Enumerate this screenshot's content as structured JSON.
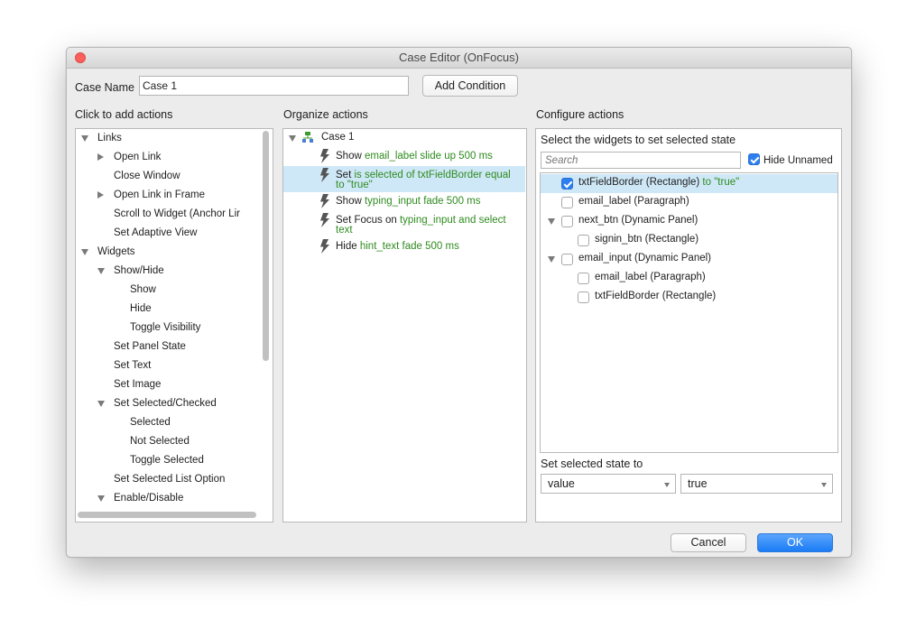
{
  "window": {
    "title": "Case Editor (OnFocus)"
  },
  "case_name": {
    "label": "Case Name",
    "value": "Case 1",
    "add_condition_label": "Add Condition"
  },
  "left": {
    "header": "Click to add actions",
    "items": [
      {
        "label": "Links",
        "caret": "down",
        "level": 0
      },
      {
        "label": "Open Link",
        "caret": "right",
        "level": 1
      },
      {
        "label": "Close Window",
        "caret": "",
        "level": 1
      },
      {
        "label": "Open Link in Frame",
        "caret": "right",
        "level": 1
      },
      {
        "label": "Scroll to Widget (Anchor Lir",
        "caret": "",
        "level": 1
      },
      {
        "label": "Set Adaptive View",
        "caret": "",
        "level": 1
      },
      {
        "label": "Widgets",
        "caret": "down",
        "level": 0
      },
      {
        "label": "Show/Hide",
        "caret": "down",
        "level": 1
      },
      {
        "label": "Show",
        "caret": "",
        "level": 2
      },
      {
        "label": "Hide",
        "caret": "",
        "level": 2
      },
      {
        "label": "Toggle Visibility",
        "caret": "",
        "level": 2
      },
      {
        "label": "Set Panel State",
        "caret": "",
        "level": 1
      },
      {
        "label": "Set Text",
        "caret": "",
        "level": 1
      },
      {
        "label": "Set Image",
        "caret": "",
        "level": 1
      },
      {
        "label": "Set Selected/Checked",
        "caret": "down",
        "level": 1
      },
      {
        "label": "Selected",
        "caret": "",
        "level": 2
      },
      {
        "label": "Not Selected",
        "caret": "",
        "level": 2
      },
      {
        "label": "Toggle Selected",
        "caret": "",
        "level": 2
      },
      {
        "label": "Set Selected List Option",
        "caret": "",
        "level": 1
      },
      {
        "label": "Enable/Disable",
        "caret": "down",
        "level": 1
      }
    ]
  },
  "middle": {
    "header": "Organize actions",
    "case_label": "Case 1",
    "actions": [
      {
        "verb": "Show",
        "line1": "email_label slide up 500 ms",
        "line2": "",
        "selected": false
      },
      {
        "verb": "Set",
        "line1": "is selected of txtFieldBorder equal",
        "line2": "to \"true\"",
        "selected": true
      },
      {
        "verb": "Show",
        "line1": "typing_input fade 500 ms",
        "line2": "",
        "selected": false
      },
      {
        "verb": "Set Focus on",
        "line1": "typing_input and select",
        "line2": "text",
        "selected": false
      },
      {
        "verb": "Hide",
        "line1": "hint_text fade 500 ms",
        "line2": "",
        "selected": false
      }
    ]
  },
  "right": {
    "header": "Configure actions",
    "select_label": "Select the widgets to set selected state",
    "search_placeholder": "Search",
    "hide_unnamed_label": "Hide Unnamed",
    "widgets": [
      {
        "name": "txtFieldBorder (Rectangle)",
        "suffix": " to \"true\"",
        "checked": true,
        "caret": false,
        "level": 0,
        "selected": true
      },
      {
        "name": "email_label (Paragraph)",
        "suffix": "",
        "checked": false,
        "caret": false,
        "level": 0,
        "selected": false
      },
      {
        "name": "next_btn (Dynamic Panel)",
        "suffix": "",
        "checked": false,
        "caret": true,
        "level": 0,
        "selected": false
      },
      {
        "name": "signin_btn (Rectangle)",
        "suffix": "",
        "checked": false,
        "caret": false,
        "level": 1,
        "selected": false
      },
      {
        "name": "email_input (Dynamic Panel)",
        "suffix": "",
        "checked": false,
        "caret": true,
        "level": 0,
        "selected": false
      },
      {
        "name": "email_label (Paragraph)",
        "suffix": "",
        "checked": false,
        "caret": false,
        "level": 1,
        "selected": false
      },
      {
        "name": "txtFieldBorder (Rectangle)",
        "suffix": "",
        "checked": false,
        "caret": false,
        "level": 1,
        "selected": false
      }
    ],
    "state_label": "Set selected state to",
    "type_select": "value",
    "value_select": "true"
  },
  "footer": {
    "cancel_label": "Cancel",
    "ok_label": "OK"
  },
  "colors": {
    "accent": "#2d7ff0",
    "green_text": "#2e8b1e",
    "selection": "#cfe8f7",
    "close_dot": "#fc605c"
  }
}
